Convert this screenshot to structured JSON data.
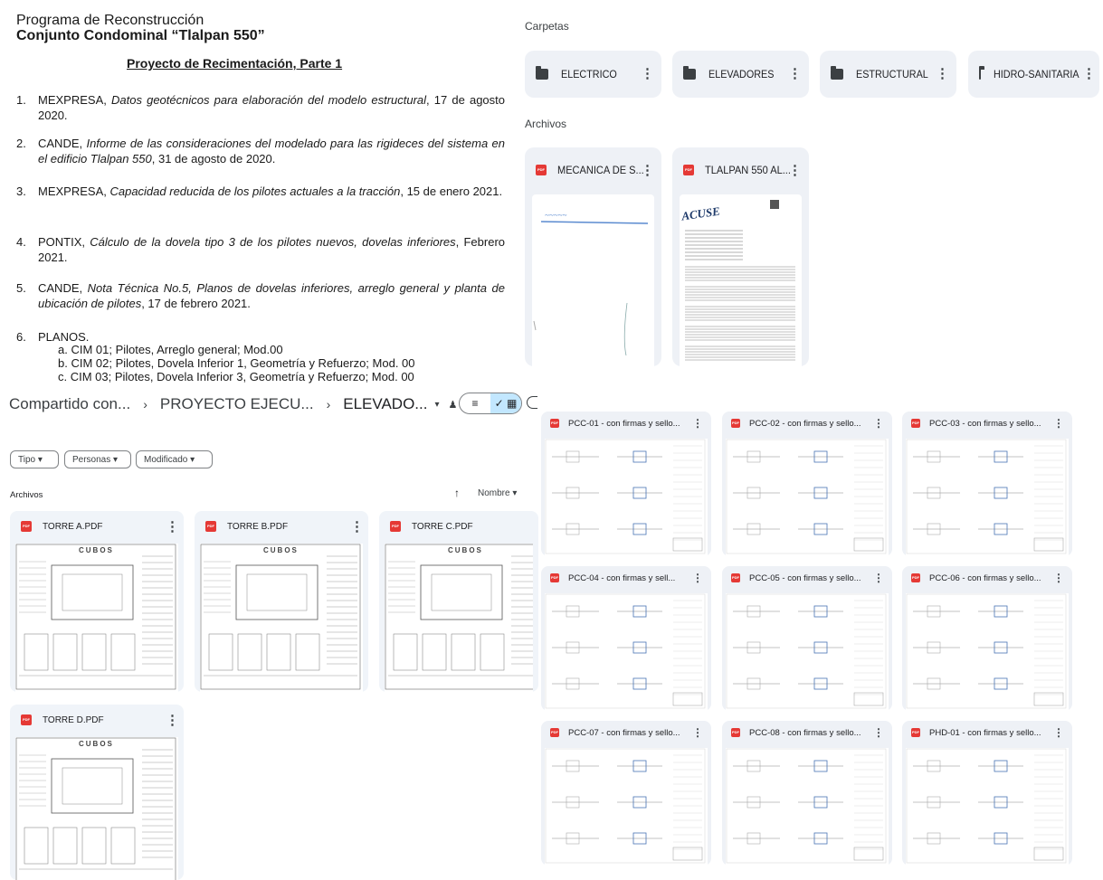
{
  "document": {
    "line1": "Programa de Reconstrucción",
    "line2": "Conjunto Condominal “Tlalpan 550”",
    "subtitle": "Proyecto de Recimentación, Parte 1",
    "items": [
      {
        "num": "1.",
        "text": "MEXPRESA, Datos geotécnicos para elaboración del modelo estructural, 17 de agosto  2020."
      },
      {
        "num": "2.",
        "text": "CANDE, Informe de las consideraciones del modelado para las rigideces del sistema en el edificio Tlalpan 550, 31 de agosto de 2020."
      },
      {
        "num": "3.",
        "text": "MEXPRESA, Capacidad reducida de los pilotes actuales a la tracción, 15 de enero 2021."
      },
      {
        "num": "4.",
        "text": "PONTIX, Cálculo de la dovela tipo 3 de los pilotes nuevos, dovelas inferiores, Febrero 2021."
      },
      {
        "num": "5.",
        "text": "CANDE, Nota Técnica No.5, Planos de dovelas inferiores, arreglo general y planta de ubicación de pilotes, 17 de febrero 2021."
      },
      {
        "num": "6.",
        "text": "PLANOS."
      }
    ],
    "planos": [
      "a.  CIM 01; Pilotes, Arreglo general; Mod.00",
      "b.  CIM 02; Pilotes, Dovela Inferior 1, Geometría y Refuerzo; Mod. 00",
      "c.  CIM 03; Pilotes, Dovela Inferior 3, Geometría y Refuerzo; Mod. 00"
    ]
  },
  "top_drive": {
    "folders_label": "Carpetas",
    "folders": [
      "ELECTRICO",
      "ELEVADORES",
      "ESTRUCTURAL",
      "HIDRO-SANITARIA"
    ],
    "files_label": "Archivos",
    "files": [
      "MECANICA DE S...",
      "TLALPAN 550 AL..."
    ],
    "stamp_text": "ACUSE"
  },
  "lower_drive": {
    "breadcrumb": [
      "Compartido con...",
      "PROYECTO EJECU...",
      "ELEVADO..."
    ],
    "filters": [
      "Tipo",
      "Personas",
      "Modificado"
    ],
    "files_label": "Archivos",
    "sort_label": "Nombre",
    "files": [
      "TORRE A.PDF",
      "TORRE B.PDF",
      "TORRE C.PDF",
      "TORRE D.PDF"
    ],
    "thumb_brand": "CUBOS"
  },
  "pcc_grid": {
    "files": [
      "PCC-01 - con firmas y sello...",
      "PCC-02 - con firmas y sello...",
      "PCC-03 - con firmas y sello...",
      "PCC-04 - con firmas y sell...",
      "PCC-05 - con firmas y sello...",
      "PCC-06 - con firmas y sello...",
      "PCC-07 - con firmas y sello...",
      "PCC-08 - con firmas y sello...",
      "PHD-01 - con firmas y sello..."
    ]
  },
  "icons": {
    "pdf": "pdf-icon",
    "folder": "folder-icon",
    "more": "more-vert-icon",
    "list": "list-view-icon",
    "grid": "grid-view-icon",
    "sort": "arrow-up-icon"
  },
  "colors": {
    "card": "#eef1f6",
    "pdf": "#e53935",
    "selected": "#c2e7ff"
  }
}
